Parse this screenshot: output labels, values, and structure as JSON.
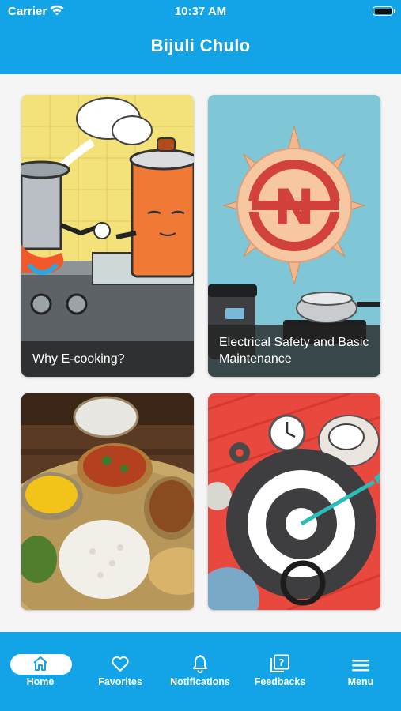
{
  "status_bar": {
    "carrier": "Carrier",
    "time": "10:37 AM"
  },
  "header": {
    "title": "Bijuli Chulo"
  },
  "cards": [
    {
      "caption": "Why E-cooking?"
    },
    {
      "caption": "Electrical Safety and Basic Maintenance",
      "logo_letter": "N"
    },
    {
      "caption": ""
    },
    {
      "caption": ""
    }
  ],
  "tabs": [
    {
      "label": "Home",
      "icon": "home-icon",
      "active": true
    },
    {
      "label": "Favorites",
      "icon": "heart-icon"
    },
    {
      "label": "Notifications",
      "icon": "bell-icon"
    },
    {
      "label": "Feedbacks",
      "icon": "feedback-icon"
    },
    {
      "label": "Menu",
      "icon": "hamburger-icon"
    }
  ],
  "colors": {
    "primary": "#12a4e6",
    "background": "#f5f5f5"
  }
}
